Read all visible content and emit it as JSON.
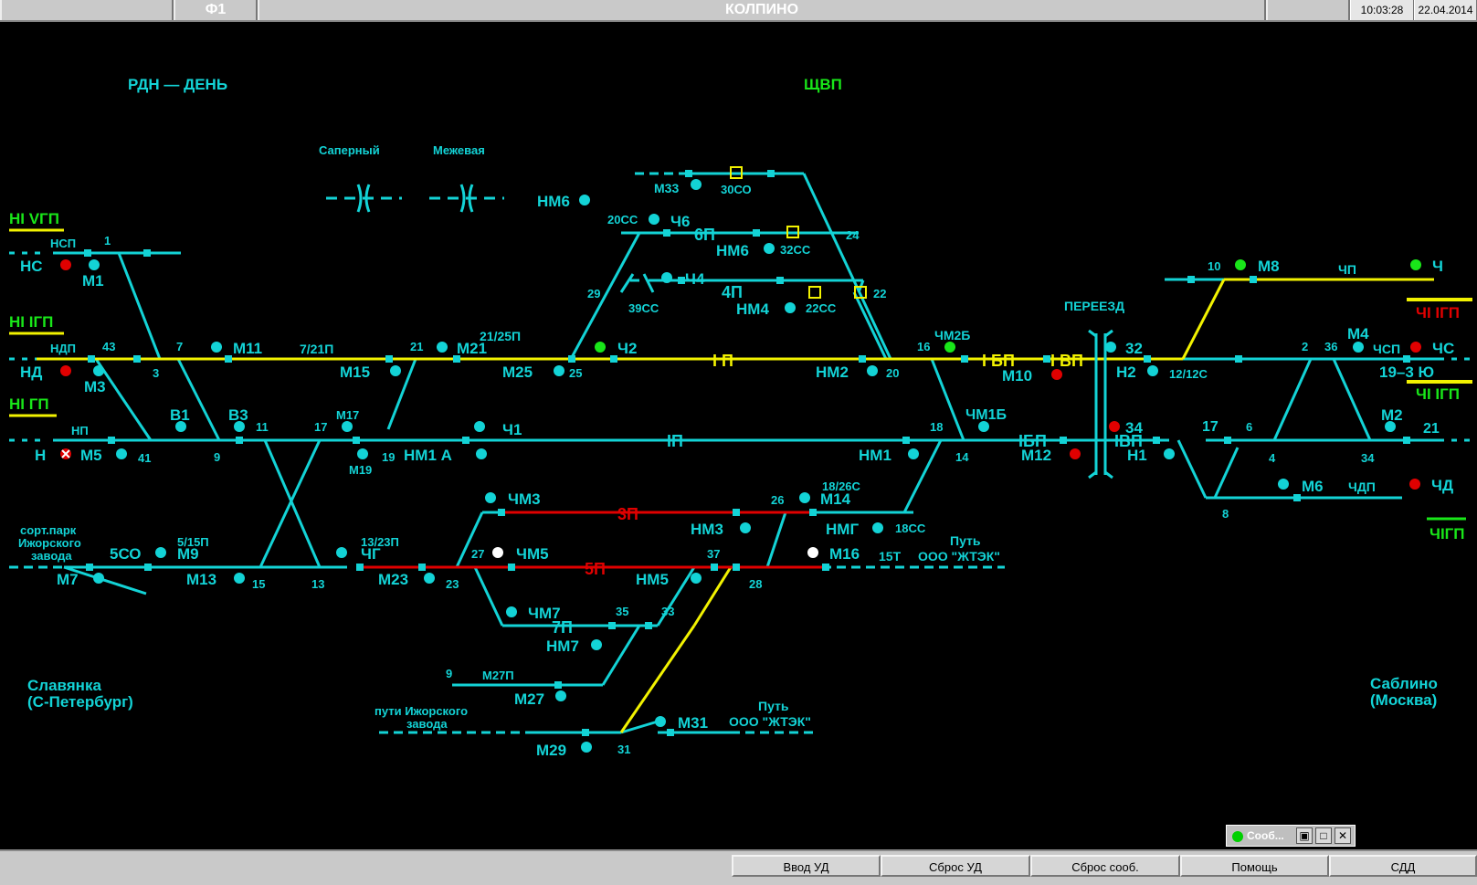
{
  "topbar": {
    "key": "Ф1",
    "station": "КОЛПИНО",
    "time": "10:03:28",
    "date": "22.04.2014"
  },
  "regions": {
    "mode": "РДН — ДЕНЬ",
    "shchvp": "ЩВП",
    "sapernyi": "Саперный",
    "mezhevaya": "Межевая",
    "pereezd": "ПЕРЕЕЗД"
  },
  "directions": {
    "slavyanka_1": "Славянка",
    "slavyanka_2": "(С-Петербург)",
    "sablino_1": "Саблино",
    "sablino_2": "(Москва)",
    "sort_1": "сорт.парк",
    "sort_2": "Ижорского",
    "sort_3": "завода",
    "izh_1": "пути Ижорского",
    "izh_2": "завода",
    "put_1": "Путь",
    "put_2": "ООО \"ЖТЭК\""
  },
  "tracks": {
    "hi_vgp": "НI VГП",
    "hi_igp": "НI IГП",
    "hi_gp": "НI ГП",
    "chi_igp_r": "ЧI IГП",
    "chi_igp_g": "ЧI IГП",
    "chigp": "ЧIГП",
    "p1": "I П",
    "p2": "IП",
    "p3": "3П",
    "p5": "5П",
    "p7": "7П",
    "p6": "6П",
    "p4": "4П",
    "ibp": "I БП",
    "ivp": "I ВП",
    "ibp2": "IБП",
    "ivp2": "IВП",
    "chp": "ЧП",
    "chdp": "ЧДП",
    "chsp": "ЧСП",
    "t15": "15Т",
    "nsp": "НСП",
    "ndp": "НДП",
    "np": "НП"
  },
  "signals": {
    "ns": "НС",
    "nd": "НД",
    "n": "Н",
    "m1": "М1",
    "m3": "М3",
    "m5": "М5",
    "m7": "М7",
    "m9": "М9",
    "m11": "М11",
    "m13": "М13",
    "m15": "М15",
    "m17": "М17",
    "m19": "М19",
    "m21": "М21",
    "m23": "М23",
    "m25": "М25",
    "m27": "М27",
    "m29": "М29",
    "m31": "М31",
    "m33": "М33",
    "nm6a": "НМ6",
    "nm6b": "НМ6",
    "ch6": "Ч6",
    "ch4": "Ч4",
    "nm4": "НМ4",
    "ch2": "Ч2",
    "ch1": "Ч1",
    "nm1a": "НМ1 А",
    "nm2": "НМ2",
    "nm1": "НМ1",
    "chm2b": "ЧМ2Б",
    "chm1b": "ЧМ1Б",
    "m10": "М10",
    "m12": "М12",
    "chm3": "ЧМ3",
    "chm5": "ЧМ5",
    "chm7": "ЧМ7",
    "nm3": "НМ3",
    "nm5": "НМ5",
    "nm7": "НМ7",
    "m14": "М14",
    "nmg": "НМГ",
    "m16": "М16",
    "chg": "ЧГ",
    "so5": "5СО",
    "v1": "В1",
    "v3": "В3",
    "n32": "32",
    "n34": "34",
    "h2": "Н2",
    "h1": "Н1",
    "m8": "М8",
    "ch": "Ч",
    "m4": "М4",
    "chs": "ЧС",
    "m2": "М2",
    "m6": "М6",
    "chd": "ЧД",
    "n193": "19–3 Ю"
  },
  "switches": {
    "s1": "1",
    "s3": "3",
    "s5_15p": "5/15П",
    "s7": "7",
    "s7_21p": "7/21П",
    "s9": "9",
    "s11": "11",
    "s13": "13",
    "s13_23p": "13/23П",
    "s15": "15",
    "s17": "17",
    "s19": "19",
    "s21": "21",
    "s21_25p": "21/25П",
    "s23": "23",
    "s25": "25",
    "s27": "27",
    "s28": "28",
    "s29": "29",
    "s31": "31",
    "s33": "33",
    "s35": "35",
    "s37": "37",
    "s41": "41",
    "s43": "43",
    "s9b": "9",
    "m27p": "М27П",
    "s20cc": "20СС",
    "s30co": "30СО",
    "s32cc": "32СС",
    "s39cc": "39СС",
    "s22cc": "22СС",
    "s24": "24",
    "s22": "22",
    "s16": "16",
    "s20": "20",
    "s18": "18",
    "s14": "14",
    "s26": "26",
    "s18_26c": "18/26С",
    "s18cc": "18СС",
    "s10": "10",
    "s2": "2",
    "s36": "36",
    "s12_12c": "12/12С",
    "s17r": "17",
    "s6": "6",
    "s4": "4",
    "s34": "34",
    "s21r": "21",
    "s8": "8"
  },
  "message_window": {
    "title": "Сооб..."
  },
  "bottom_buttons": [
    "Ввод УД",
    "Сброс УД",
    "Сброс сооб.",
    "Помощь",
    "СДД"
  ],
  "colors": {
    "cyan": "#13d3d6",
    "yellow": "#f2f200",
    "red": "#e00000",
    "green": "#19e619",
    "bg": "#000000"
  }
}
